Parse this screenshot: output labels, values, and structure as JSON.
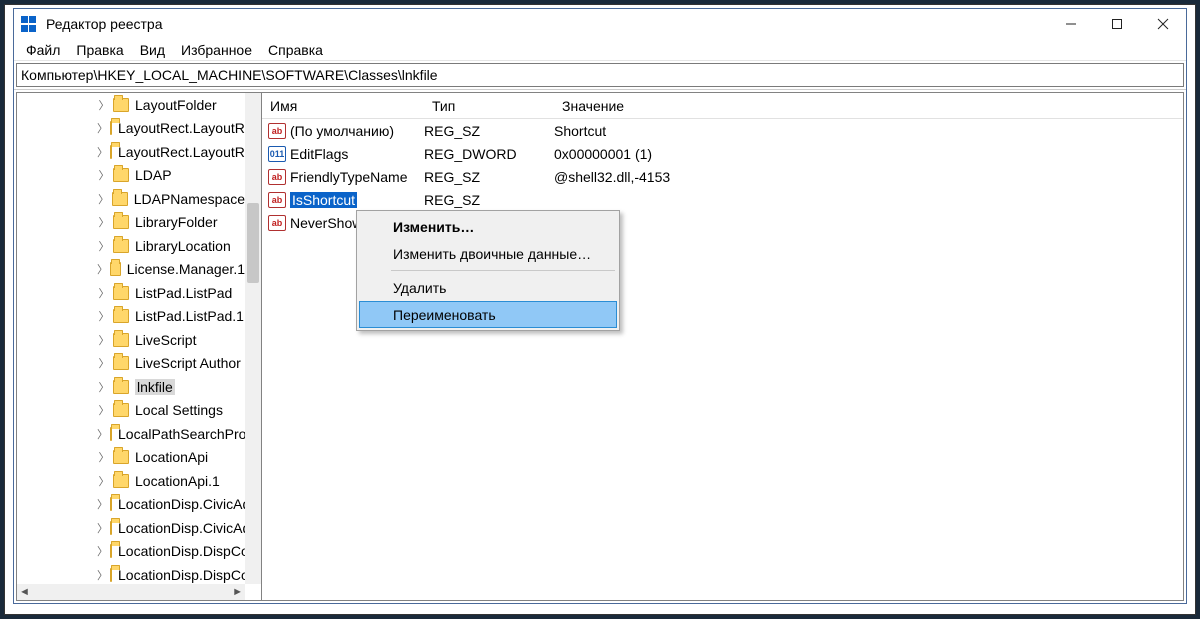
{
  "window": {
    "title": "Редактор реестра"
  },
  "menu": [
    "Файл",
    "Правка",
    "Вид",
    "Избранное",
    "Справка"
  ],
  "address": "Компьютер\\HKEY_LOCAL_MACHINE\\SOFTWARE\\Classes\\lnkfile",
  "tree": [
    {
      "label": "LayoutFolder",
      "sel": false
    },
    {
      "label": "LayoutRect.LayoutRect",
      "sel": false
    },
    {
      "label": "LayoutRect.LayoutRect",
      "sel": false
    },
    {
      "label": "LDAP",
      "sel": false
    },
    {
      "label": "LDAPNamespace",
      "sel": false
    },
    {
      "label": "LibraryFolder",
      "sel": false
    },
    {
      "label": "LibraryLocation",
      "sel": false
    },
    {
      "label": "License.Manager.1",
      "sel": false
    },
    {
      "label": "ListPad.ListPad",
      "sel": false
    },
    {
      "label": "ListPad.ListPad.1",
      "sel": false
    },
    {
      "label": "LiveScript",
      "sel": false
    },
    {
      "label": "LiveScript Author",
      "sel": false
    },
    {
      "label": "lnkfile",
      "sel": true
    },
    {
      "label": "Local Settings",
      "sel": false
    },
    {
      "label": "LocalPathSearchProvider",
      "sel": false
    },
    {
      "label": "LocationApi",
      "sel": false
    },
    {
      "label": "LocationApi.1",
      "sel": false
    },
    {
      "label": "LocationDisp.CivicAddress",
      "sel": false
    },
    {
      "label": "LocationDisp.CivicAddress",
      "sel": false
    },
    {
      "label": "LocationDisp.DispCoordinate",
      "sel": false
    },
    {
      "label": "LocationDisp.DispCoordinate",
      "sel": false
    }
  ],
  "columns": {
    "name": "Имя",
    "type": "Тип",
    "value": "Значение"
  },
  "values": [
    {
      "icon": "str",
      "name": "(По умолчанию)",
      "type": "REG_SZ",
      "value": "Shortcut",
      "sel": false
    },
    {
      "icon": "bin",
      "name": "EditFlags",
      "type": "REG_DWORD",
      "value": "0x00000001 (1)",
      "sel": false
    },
    {
      "icon": "str",
      "name": "FriendlyTypeName",
      "type": "REG_SZ",
      "value": "@shell32.dll,-4153",
      "sel": false
    },
    {
      "icon": "str",
      "name": "IsShortcut",
      "type": "REG_SZ",
      "value": "",
      "sel": true
    },
    {
      "icon": "str",
      "name": "NeverShowExt",
      "type": "",
      "value": "",
      "sel": false
    }
  ],
  "ctx": {
    "modify": "Изменить…",
    "modifyBin": "Изменить двоичные данные…",
    "delete": "Удалить",
    "rename": "Переименовать"
  }
}
